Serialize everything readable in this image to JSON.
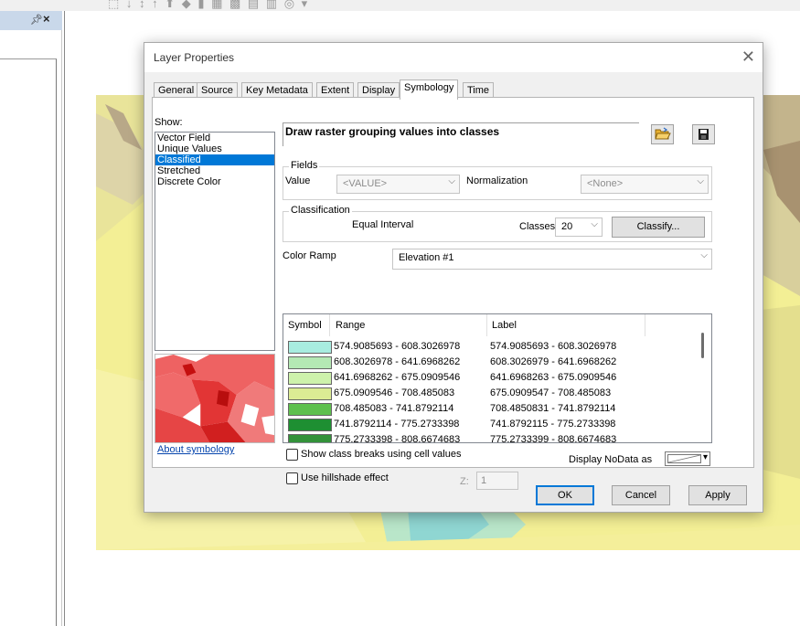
{
  "app": {
    "toolbar_glyphs": "⬚ ↓ ↕ ↑ ⬆ ◆ ▮ ▦ ▩ ▤ ▥ ◎ ▾",
    "toc_pin_glyph": "p",
    "toc_close_glyph": "×"
  },
  "dialog": {
    "title": "Layer Properties",
    "close_glyph": "✕",
    "tabs": [
      "General",
      "Source",
      "Key Metadata",
      "Extent",
      "Display",
      "Symbology",
      "Time"
    ],
    "active_tab": "Symbology"
  },
  "symbology": {
    "show_label": "Show:",
    "show_items": [
      "Vector Field",
      "Unique Values",
      "Classified",
      "Stretched",
      "Discrete Color"
    ],
    "show_selected": "Classified",
    "heading": "Draw raster grouping values into classes",
    "about_link": "About symbology",
    "fields": {
      "group_label": "Fields",
      "value_label": "Value",
      "value": "<VALUE>",
      "normalization_label": "Normalization",
      "normalization": "<None>"
    },
    "classification": {
      "group_label": "Classification",
      "method": "Equal Interval",
      "classes_label": "Classes",
      "classes": "20",
      "classify_button": "Classify..."
    },
    "color_ramp": {
      "label": "Color Ramp",
      "value": "Elevation #1"
    },
    "table": {
      "headers": [
        "Symbol",
        "Range",
        "Label"
      ],
      "rows": [
        {
          "color": "#a8ece0",
          "range": "574.9085693 - 608.3026978",
          "label": "574.9085693 - 608.3026978"
        },
        {
          "color": "#b4e8b4",
          "range": "608.3026978 - 641.6968262",
          "label": "608.3026979 - 641.6968262"
        },
        {
          "color": "#cdf2ab",
          "range": "641.6968262 - 675.0909546",
          "label": "641.6968263 - 675.0909546"
        },
        {
          "color": "#dcec94",
          "range": "675.0909546 - 708.485083",
          "label": "675.0909547 - 708.485083"
        },
        {
          "color": "#5ec04e",
          "range": "708.485083 - 741.8792114",
          "label": "708.4850831 - 741.8792114"
        },
        {
          "color": "#1e8f32",
          "range": "741.8792114 - 775.2733398",
          "label": "741.8792115 - 775.2733398"
        },
        {
          "color": "#33923a",
          "range": "775.2733398 - 808.6674683",
          "label": "775.2733399 - 808.6674683"
        }
      ]
    },
    "show_class_breaks_label": "Show class breaks using cell values",
    "hillshade_label": "Use hillshade effect",
    "z_label": "Z:",
    "z_value": "1",
    "nodata_label": "Display NoData as"
  },
  "buttons": {
    "ok": "OK",
    "cancel": "Cancel",
    "apply": "Apply"
  }
}
